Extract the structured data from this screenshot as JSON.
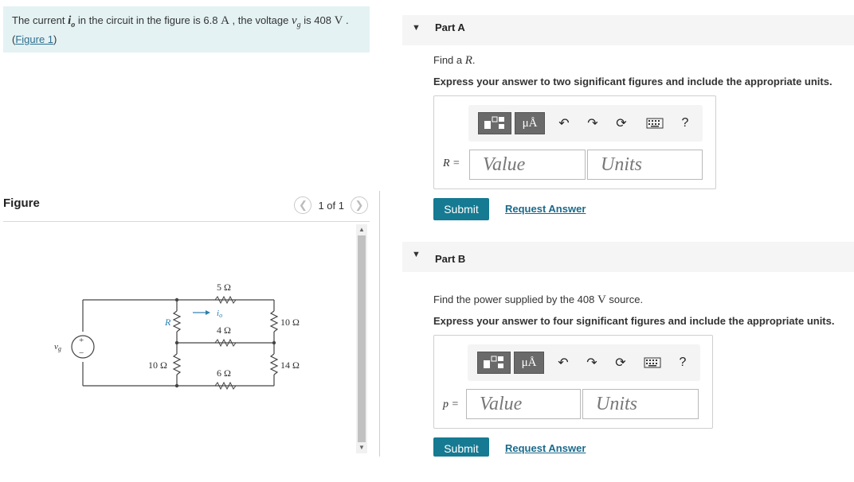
{
  "problem": {
    "text_before": "The current ",
    "var_io": "i",
    "var_io_sub": "o",
    "text_middle": " in the circuit in the figure is 6.8 ",
    "unit_A": "A",
    "text_middle2": " , the voltage ",
    "var_vg": "v",
    "var_vg_sub": "g",
    "text_middle3": " is 408 ",
    "unit_V": "V",
    "text_after": " .",
    "figure_link": "Figure 1"
  },
  "figure": {
    "title": "Figure",
    "pager": "1 of 1",
    "prev_icon": "chevron-left-icon",
    "next_icon": "chevron-right-icon",
    "circuit_labels": {
      "r5": "5 Ω",
      "r4": "4 Ω",
      "r6": "6 Ω",
      "r10_right": "10 Ω",
      "r14": "14 Ω",
      "r10_left": "10 Ω",
      "R": "R",
      "io": "i",
      "io_sub": "o",
      "vg": "v",
      "vg_sub": "g",
      "plus": "+",
      "minus": "−"
    }
  },
  "partA": {
    "title": "Part A",
    "find_text": "Find a ",
    "find_var": "R",
    "find_end": ".",
    "instruction": "Express your answer to two significant figures and include the appropriate units.",
    "label": "R =",
    "value_placeholder": "Value",
    "units_placeholder": "Units",
    "submit": "Submit",
    "request": "Request Answer"
  },
  "partB": {
    "title": "Part B",
    "find_text": "Find the power supplied by the 408 ",
    "find_unit": "V",
    "find_end": " source.",
    "instruction": "Express your answer to four significant figures and include the appropriate units.",
    "label": "p =",
    "value_placeholder": "Value",
    "units_placeholder": "Units",
    "submit": "Submit",
    "request": "Request Answer"
  },
  "toolbar": {
    "mu_label": "μÅ",
    "help": "?",
    "icons": [
      "templates-icon",
      "units-icon",
      "undo-icon",
      "redo-icon",
      "reset-icon",
      "keyboard-icon",
      "help-icon"
    ]
  }
}
